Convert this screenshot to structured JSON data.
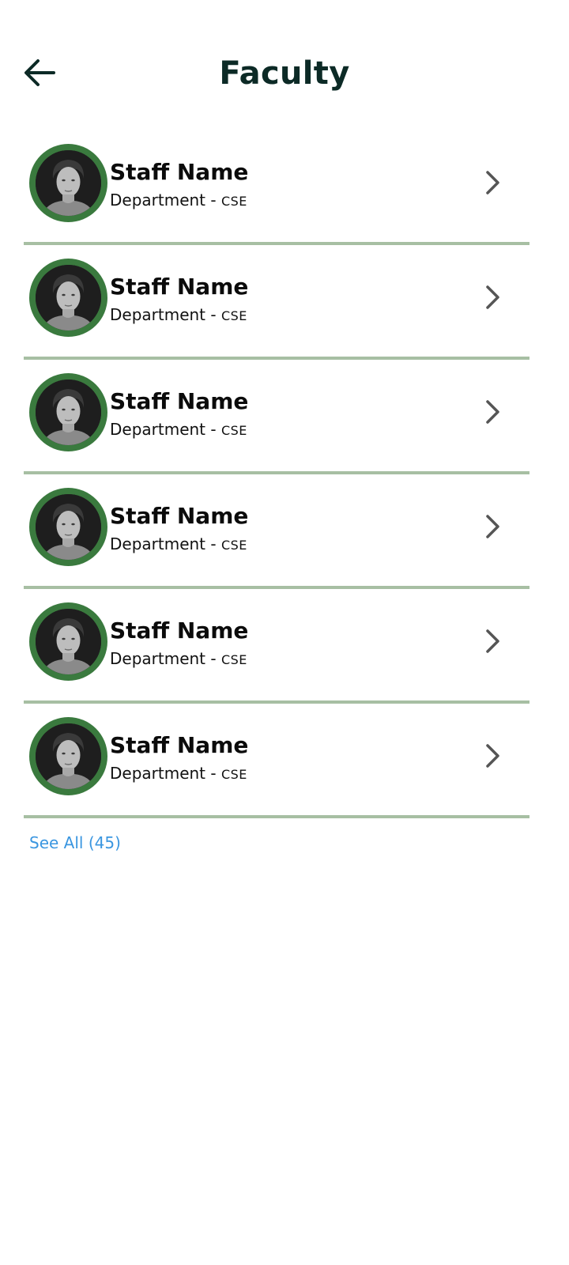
{
  "header": {
    "title": "Faculty",
    "back_icon": "arrow-left-icon"
  },
  "colors": {
    "title": "#0c2a26",
    "avatar_ring": "#3a7a3e",
    "divider": "#a7bfa3",
    "link": "#3a96e0",
    "chevron": "#555555"
  },
  "faculty": [
    {
      "name": "Staff Name",
      "department_prefix": "Department - ",
      "department_code": "CSE"
    },
    {
      "name": "Staff Name",
      "department_prefix": "Department - ",
      "department_code": "CSE"
    },
    {
      "name": "Staff Name",
      "department_prefix": "Department - ",
      "department_code": "CSE"
    },
    {
      "name": "Staff Name",
      "department_prefix": "Department - ",
      "department_code": "CSE"
    },
    {
      "name": "Staff Name",
      "department_prefix": "Department - ",
      "department_code": "CSE"
    },
    {
      "name": "Staff Name",
      "department_prefix": "Department - ",
      "department_code": "CSE"
    }
  ],
  "footer": {
    "see_all_label": "See All (45)"
  }
}
